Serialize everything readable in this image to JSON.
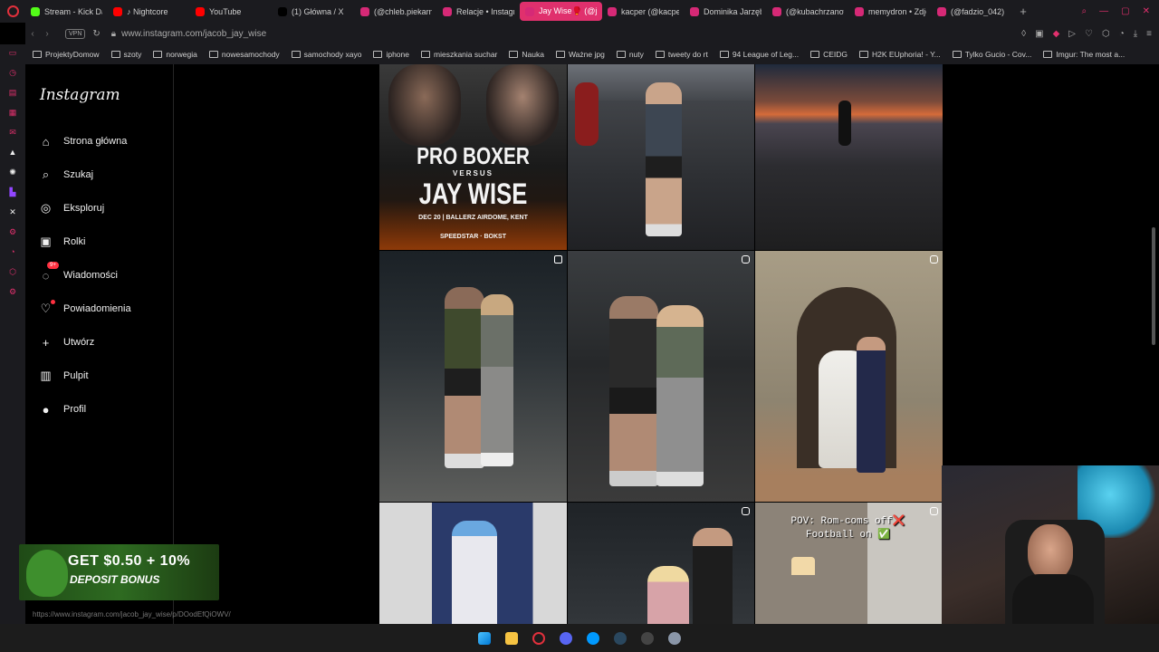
{
  "tabs": [
    {
      "label": "Stream - Kick Dashboard",
      "fav": "#53fc18"
    },
    {
      "label": "♪ Nightcore",
      "fav": "#ff0000"
    },
    {
      "label": "YouTube",
      "fav": "#ff0000"
    },
    {
      "label": "(1) Główna / X",
      "fav": "#000000"
    },
    {
      "label": "(@chleb.piekarnia",
      "fav": "#d62976"
    },
    {
      "label": "Relacje • Instagram",
      "fav": "#d62976"
    },
    {
      "label": "Jay Wise🥊 (@jacob_jay_wise)",
      "fav": "#d62976",
      "active": true
    },
    {
      "label": "kacper (@kacper",
      "fav": "#d62976"
    },
    {
      "label": "Dominika Jarzęb",
      "fav": "#d62976"
    },
    {
      "label": "(@kubachrzanowski",
      "fav": "#d62976"
    },
    {
      "label": "memydron • Zdjęcia",
      "fav": "#d62976"
    },
    {
      "label": "(@fadzio_042)",
      "fav": "#d62976"
    }
  ],
  "address": {
    "vpn": "VPN",
    "url": "www.instagram.com/jacob_jay_wise"
  },
  "bookmarks": [
    "ProjektyDomow",
    "szoty",
    "norwegia",
    "nowesamochody",
    "samochody xayo",
    "iphone",
    "mieszkania suchar",
    "Nauka",
    "Ważne jpg",
    "nuty",
    "tweety do rt",
    "94 League of Leg...",
    "CEIDG",
    "H2K EUphoria! - Y...",
    "Tylko Gucio - Cov...",
    "Imgur: The most a..."
  ],
  "instagram": {
    "logo": "Instagram",
    "nav": [
      {
        "label": "Strona główna",
        "icon": "home-icon"
      },
      {
        "label": "Szukaj",
        "icon": "search-icon"
      },
      {
        "label": "Eksploruj",
        "icon": "compass-icon"
      },
      {
        "label": "Rolki",
        "icon": "reels-icon"
      },
      {
        "label": "Wiadomości",
        "icon": "messenger-icon",
        "badge": "9+"
      },
      {
        "label": "Powiadomienia",
        "icon": "heart-icon",
        "dot": true
      },
      {
        "label": "Utwórz",
        "icon": "plus-icon"
      },
      {
        "label": "Pulpit",
        "icon": "dashboard-icon"
      },
      {
        "label": "Profil",
        "icon": "avatar-icon"
      }
    ]
  },
  "posts": {
    "poster": {
      "line1": "PRO BOXER",
      "line2": "VERSUS",
      "line3": "JAY WISE",
      "line4": "DEC 20 | BALLERZ AIRDOME, KENT",
      "sponsors": "SPEEDSTAR · BOKST"
    },
    "pov": {
      "line1": "POV: Rom-coms off❌",
      "line2": "Football on ✅"
    }
  },
  "promo": {
    "line1": "GET $0.50 + 10%",
    "line2": "DEPOSIT BONUS"
  },
  "status_url": "https://www.instagram.com/jacob_jay_wise/p/DOodEfQiOWV/"
}
